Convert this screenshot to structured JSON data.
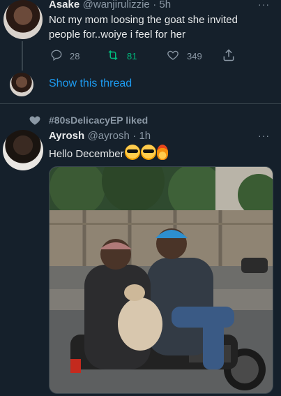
{
  "tweet1": {
    "name": "Asake",
    "handle": "@wanjirulizzie",
    "time": "· 5h",
    "text_line1": "Not my mom loosing the goat she invited",
    "text_line2": "people for..woiye i feel for her",
    "reply_count": "28",
    "retweet_count": "81",
    "like_count": "349",
    "more": "···"
  },
  "thread": {
    "show_label": "Show this thread"
  },
  "liked": {
    "text": "#80sDelicacyEP liked"
  },
  "tweet2": {
    "name": "Ayrosh",
    "handle": "@ayrosh",
    "time": "· 1h",
    "text": "Hello December",
    "more": "···"
  },
  "icons": {
    "reply": "reply-icon",
    "retweet": "retweet-icon",
    "like": "heart-icon",
    "share": "share-icon"
  },
  "colors": {
    "background": "#15202b",
    "link": "#1d9bf0",
    "retweet_active": "#00ba7c",
    "muted": "#8b98a5"
  }
}
